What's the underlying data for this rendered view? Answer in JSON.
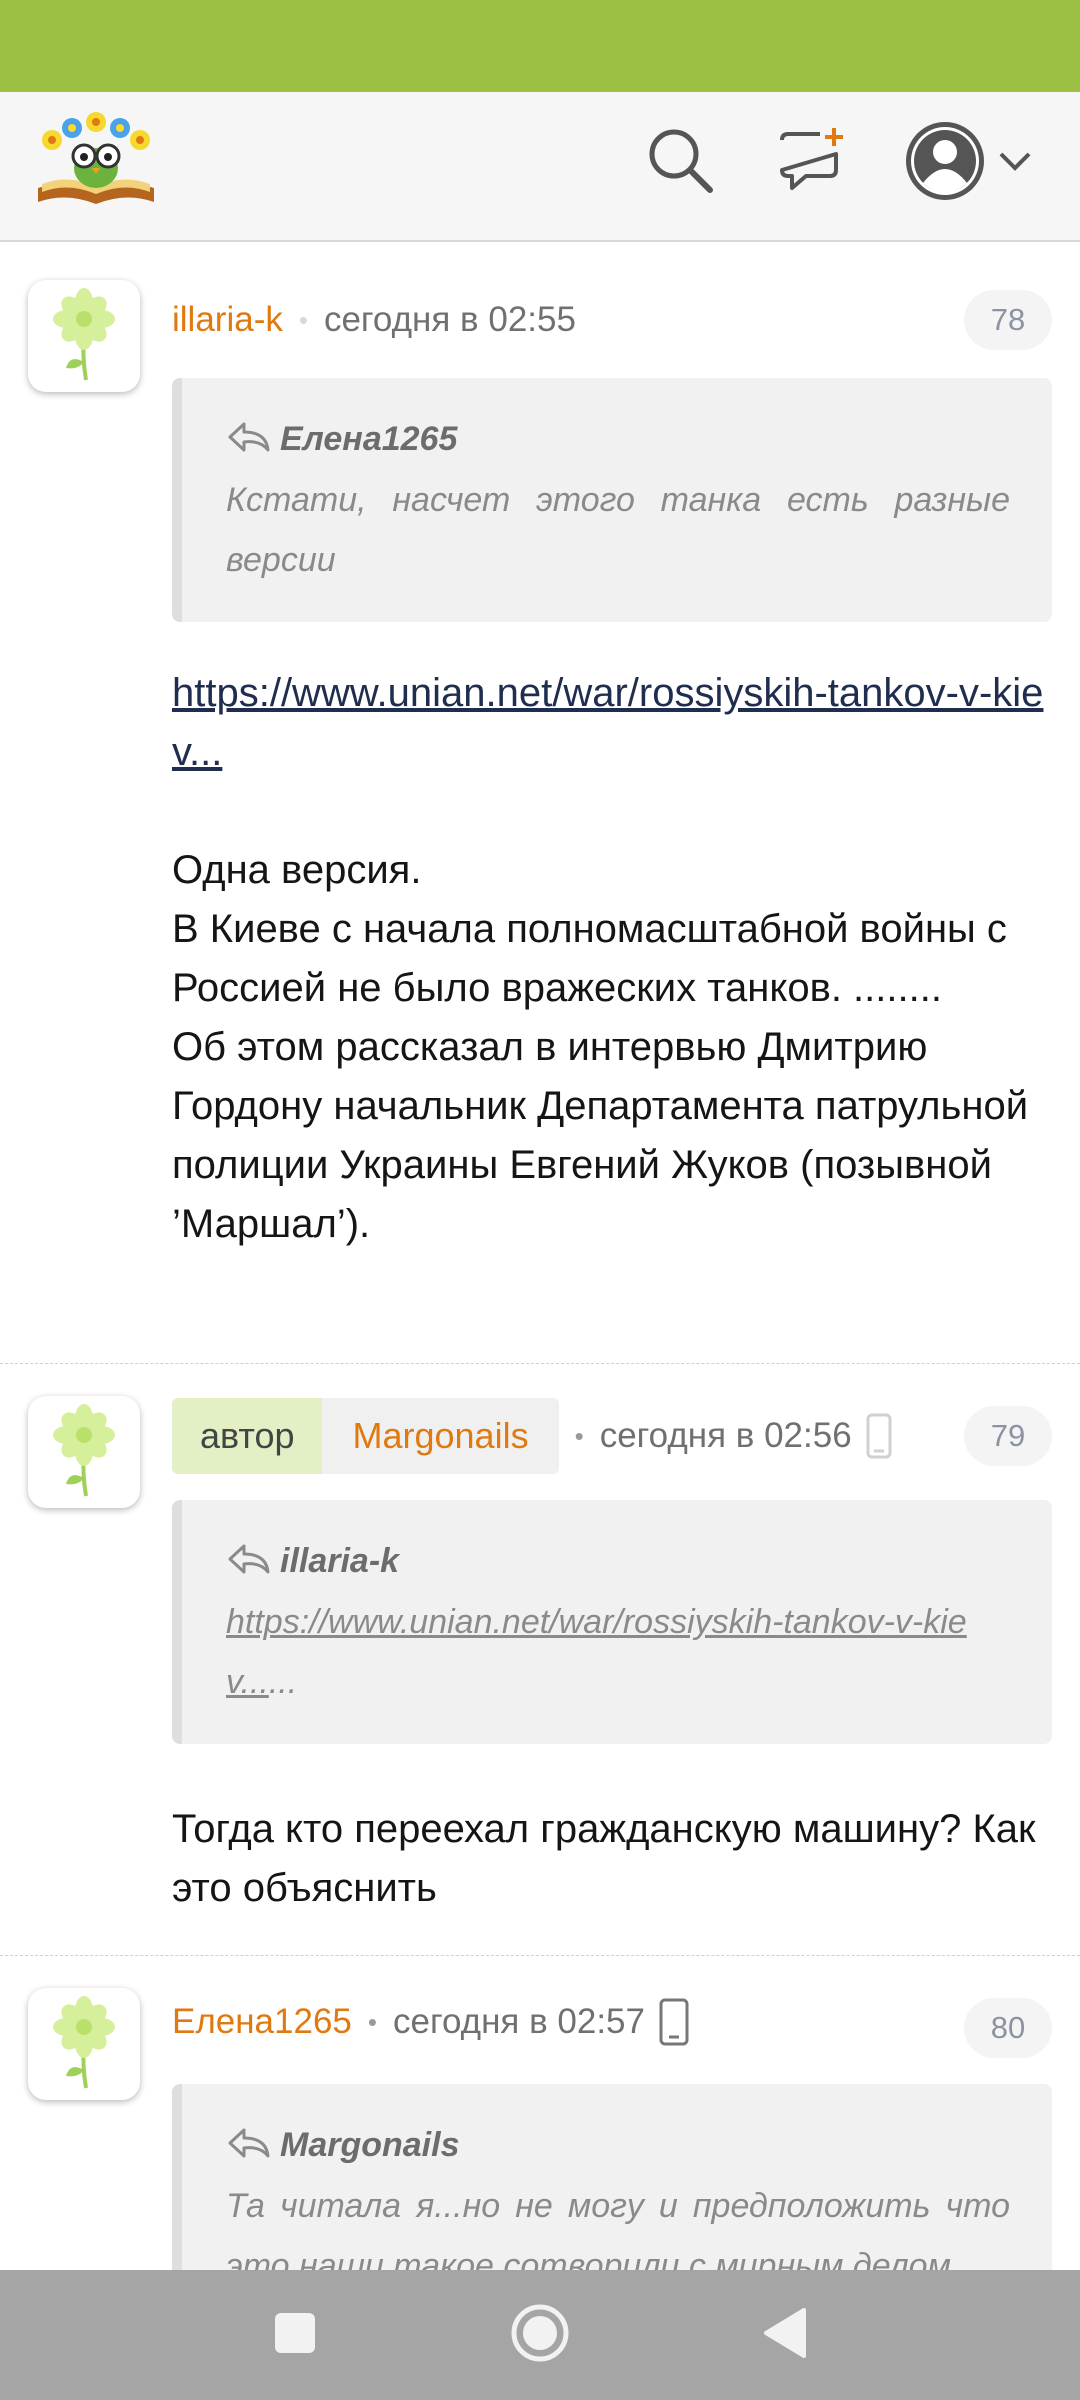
{
  "colors": {
    "status_bar": "#9bc044",
    "author": "#e07a10",
    "link": "#1f2d4f",
    "quote_bg": "#f1f1f1",
    "nav_bar": "#a5a5a5"
  },
  "header": {
    "logo": "flower-book-owl-logo",
    "icons": [
      "search-icon",
      "new-message-icon",
      "user-avatar-icon",
      "chevron-down-icon"
    ]
  },
  "comments": [
    {
      "author": "illaria-k",
      "time": "сегодня в 02:55",
      "number": "78",
      "quote": {
        "author": "Елена1265",
        "text": "Кстати, насчет этого танка есть разные версии"
      },
      "link": "https://www.unian.net/war/rossiyskih-tankov-v-kiev...",
      "paragraphs": [
        "Одна версия.",
        "В Киеве с начала полномасштабной войны с Россией не было вражеских танков. ........",
        "Об этом рассказал в интервью Дмитрию Гордону начальник Департамента патрульной полиции Украины Евгений Жуков (позывной ’Маршал’)."
      ]
    },
    {
      "badge": "автор",
      "author": "Margonails",
      "time": "сегодня в 02:56",
      "number": "79",
      "quote": {
        "author": "illaria-k",
        "link": "https://www.unian.net/war/rossiyskih-tankov-v-kiev...",
        "suffix": "..."
      },
      "paragraphs": [
        "Тогда кто переехал гражданскую машину? Как это объяснить"
      ]
    },
    {
      "author": "Елена1265",
      "time": "сегодня в 02:57",
      "number": "80",
      "quote": {
        "author": "Margonails",
        "text": "Та читала я...но не могу и предположить что это наши такое сотворили с мирным делом"
      }
    }
  ],
  "nav": {
    "icons": [
      "recent-apps-icon",
      "home-icon",
      "back-icon"
    ]
  }
}
